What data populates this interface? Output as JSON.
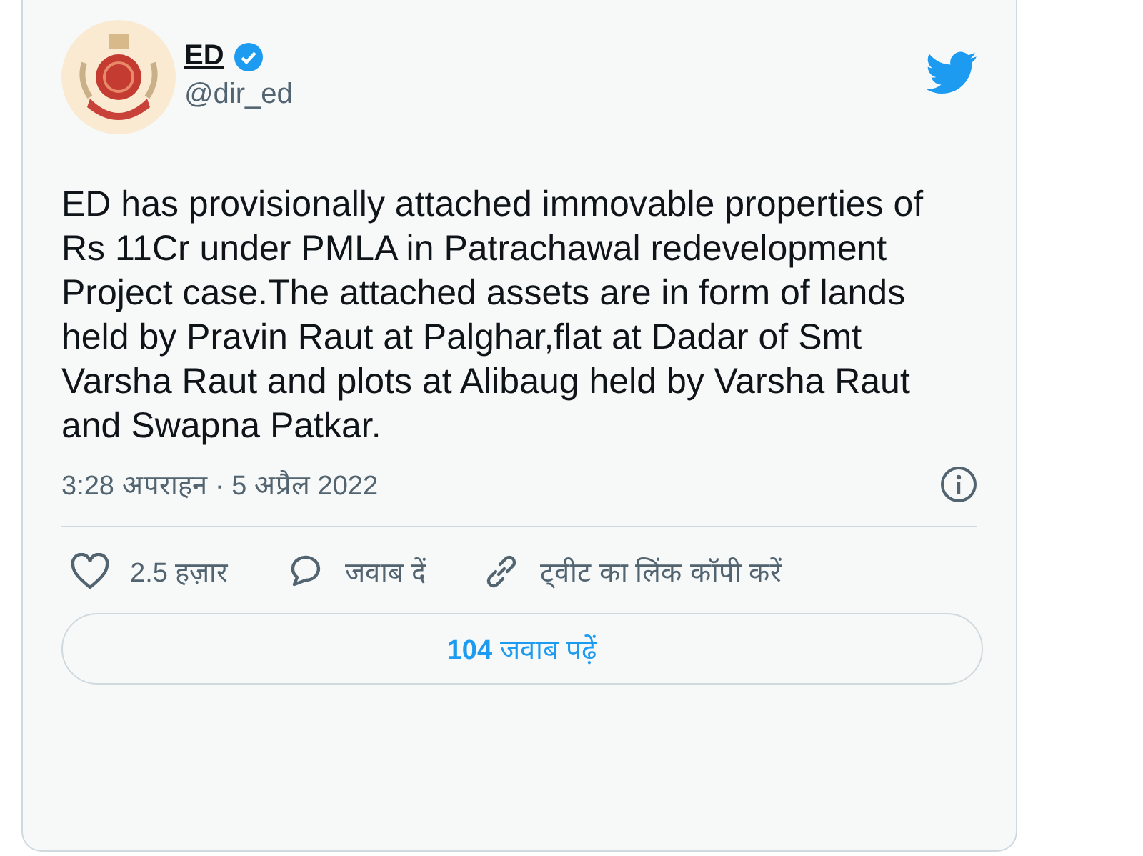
{
  "author": {
    "name": "ED",
    "verified": true,
    "handle": "@dir_ed"
  },
  "text": "ED has provisionally attached immovable properties of Rs 11Cr under PMLA in Patrachawal redevelopment Project case.The attached assets are in form of lands held by Pravin Raut at Palghar,flat at Dadar of Smt Varsha Raut and plots at Alibaug held by Varsha Raut and Swapna Patkar.",
  "timestamp": "3:28 अपराहन · 5 अप्रैल 2022",
  "actions": [
    {
      "kind": "like",
      "label": "2.5 हज़ार"
    },
    {
      "kind": "reply",
      "label": "जवाब दें"
    },
    {
      "kind": "link",
      "label": "ट्वीट का लिंक कॉपी करें"
    }
  ],
  "replies_button": {
    "count": "104",
    "label": "जवाब पढ़ें"
  }
}
